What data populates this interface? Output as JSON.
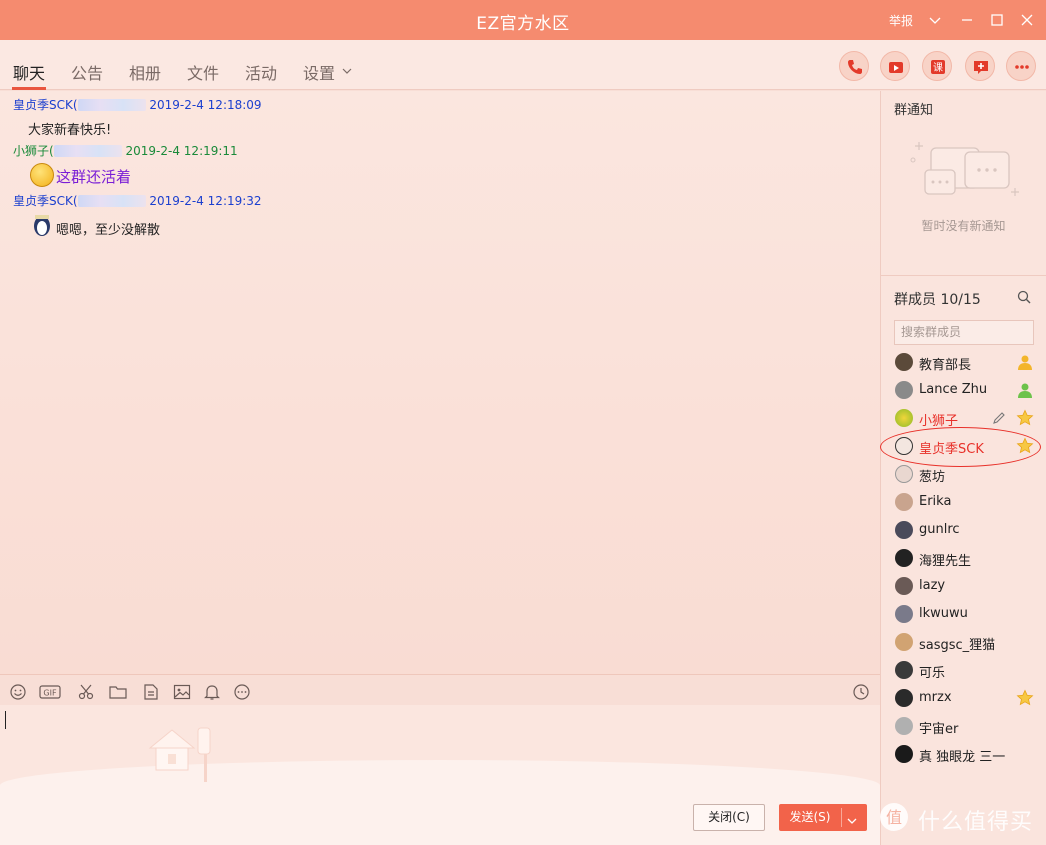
{
  "window": {
    "title": "EZ官方水区",
    "report_label": "举报"
  },
  "tabs": [
    {
      "label": "聊天",
      "active": true
    },
    {
      "label": "公告"
    },
    {
      "label": "相册"
    },
    {
      "label": "文件"
    },
    {
      "label": "活动"
    },
    {
      "label": "设置"
    }
  ],
  "messages": [
    {
      "sender": "皇贞季SCK(",
      "time": "2019-2-4 12:18:09",
      "text": "大家新春快乐!",
      "sender_color": "#1b3fcf"
    },
    {
      "sender": "小狮子(",
      "time": "2019-2-4 12:19:11",
      "text": "这群还活着",
      "sender_color": "#1a8a3a",
      "text_color": "#7a1ed6"
    },
    {
      "sender": "皇贞季SCK(",
      "time": "2019-2-4 12:19:32",
      "text": "嗯嗯，至少没解散",
      "sender_color": "#1b3fcf"
    }
  ],
  "composer": {
    "close_label": "关闭(C)",
    "send_label": "发送(S)"
  },
  "notice": {
    "title": "群通知",
    "empty_text": "暂时没有新通知"
  },
  "members": {
    "title": "群成员 10/15",
    "search_placeholder": "搜索群成员",
    "list": [
      {
        "name": "教育部長",
        "badge": "admin-person"
      },
      {
        "name": "Lance Zhu",
        "badge": "member-person"
      },
      {
        "name": "小狮子",
        "badge": "star",
        "red": true,
        "editable": true
      },
      {
        "name": "皇贞季SCK",
        "badge": "star",
        "red": true
      },
      {
        "name": "葱坊",
        "badge": ""
      },
      {
        "name": "Erika",
        "badge": ""
      },
      {
        "name": "gunlrc",
        "badge": ""
      },
      {
        "name": "海狸先生",
        "badge": ""
      },
      {
        "name": "lazy",
        "badge": ""
      },
      {
        "name": "lkwuwu",
        "badge": ""
      },
      {
        "name": "sasgsc_狸猫",
        "badge": ""
      },
      {
        "name": "可乐",
        "badge": ""
      },
      {
        "name": "mrzx",
        "badge": "star"
      },
      {
        "name": "宇宙er",
        "badge": ""
      },
      {
        "name": "真 独眼龙 三一",
        "badge": ""
      }
    ]
  },
  "watermark": {
    "text": "什么值得买"
  },
  "colors": {
    "titlebar": "#f58b6f",
    "accent": "#e9553f",
    "send_button": "#f2634a",
    "highlight_name": "#e8312a"
  }
}
